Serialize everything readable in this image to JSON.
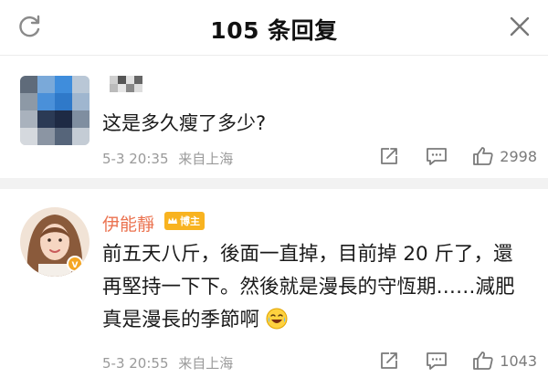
{
  "header": {
    "title": "105 条回复",
    "refresh_icon": "refresh-icon",
    "close_icon": "close-icon"
  },
  "comments": [
    {
      "username": "",
      "text": "这是多久瘦了多少?",
      "time": "5-3 20:35",
      "source": "来自上海",
      "likes": "2998"
    },
    {
      "username": "伊能靜",
      "badge": "博主",
      "text": "前五天八斤，後面一直掉，目前掉 20 斤了，還再堅持一下下。然後就是漫長的守恆期……減肥真是漫長的季節啊",
      "emoji": "laugh-cry-emoji",
      "time": "5-3 20:55",
      "source": "来自上海",
      "likes": "1043"
    }
  ],
  "colors": {
    "username": "#eb7350",
    "badge": "#f8b320",
    "meta": "#9a9a9a",
    "separator": "#f2f2f2"
  }
}
